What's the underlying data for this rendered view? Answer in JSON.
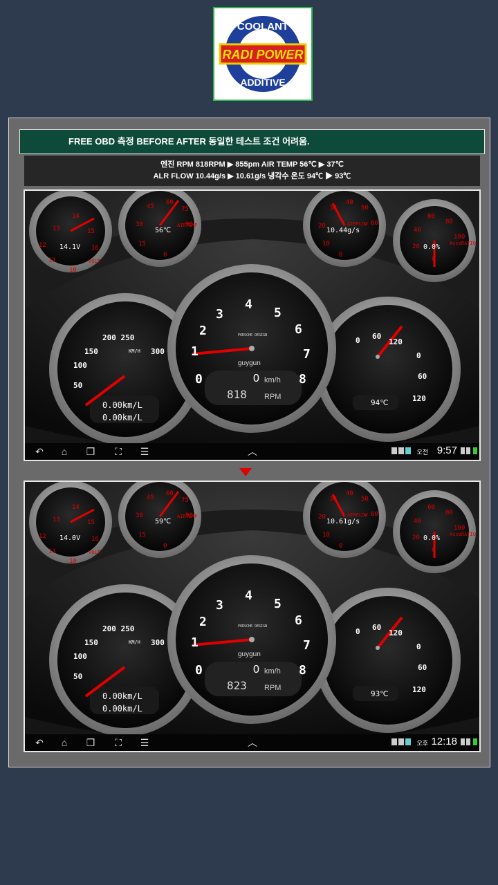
{
  "logo": {
    "text_top": "COOLANT",
    "text_mid": "RADI POWER",
    "text_bottom": "ADDITIVE"
  },
  "header": {
    "title": "FREE OBD 측정 BEFORE  AFTER  동일한 테스트 조건 어려움.",
    "line1": "엔진 RPM 818RPM ▶ 855pm   AIR TEMP 56℃ ▶ 37℃",
    "line2": "ALR FLOW 10.44g/s ▶ 10.61g/s   냉각수 온도 94℃ ▶ 93℃"
  },
  "before": {
    "volt": "14.1V",
    "airtemp": "56℃",
    "airflow": "10.44g/s",
    "ratio": "0.0%",
    "speed": "0",
    "speed_unit": "km/h",
    "rpm": "818",
    "rpm_unit": "RPM",
    "fuel1": "0.00km/L",
    "fuel2": "0.00km/L",
    "coolant": "94℃",
    "ampm": "오전",
    "time": "9:57"
  },
  "after": {
    "volt": "14.0V",
    "airtemp": "59℃",
    "airflow": "10.61g/s",
    "ratio": "0.0%",
    "speed": "0",
    "speed_unit": "km/h",
    "rpm": "823",
    "rpm_unit": "RPM",
    "fuel1": "0.00km/L",
    "fuel2": "0.00km/L",
    "coolant": "93℃",
    "ampm": "오후",
    "time": "12:18"
  },
  "gauge_labels": {
    "brand": "guygun",
    "porsche": "PORSCHE DESIGN",
    "speed_ticks": [
      "50",
      "100",
      "150",
      "200 250",
      "300"
    ],
    "rpm_ticks": [
      "0",
      "1",
      "2",
      "3",
      "4",
      "5",
      "6",
      "7",
      "8"
    ],
    "temp_ticks": [
      "0",
      "60",
      "120",
      "0",
      "60",
      "120"
    ],
    "volt_ticks": [
      "10",
      "11",
      "12",
      "13",
      "14",
      "15",
      "16"
    ],
    "airtemp_ticks": [
      "0",
      "15",
      "30",
      "45",
      "60",
      "75",
      "90"
    ],
    "airflow_ticks": [
      "0",
      "10",
      "20",
      "30",
      "40",
      "50",
      "60"
    ],
    "ratio_ticks": [
      "0",
      "20",
      "40",
      "60",
      "80",
      "100"
    ],
    "volt_name": "VOLT",
    "airtemp_name": "AIRTEMP",
    "airflow_name": "AIRFLOW",
    "ratio_name": "AcceRATIO",
    "kmh": "KM/H"
  },
  "colors": {
    "accent": "#e00000",
    "title_bg": "#0d4a3a",
    "page_bg": "#2e3a4e"
  }
}
